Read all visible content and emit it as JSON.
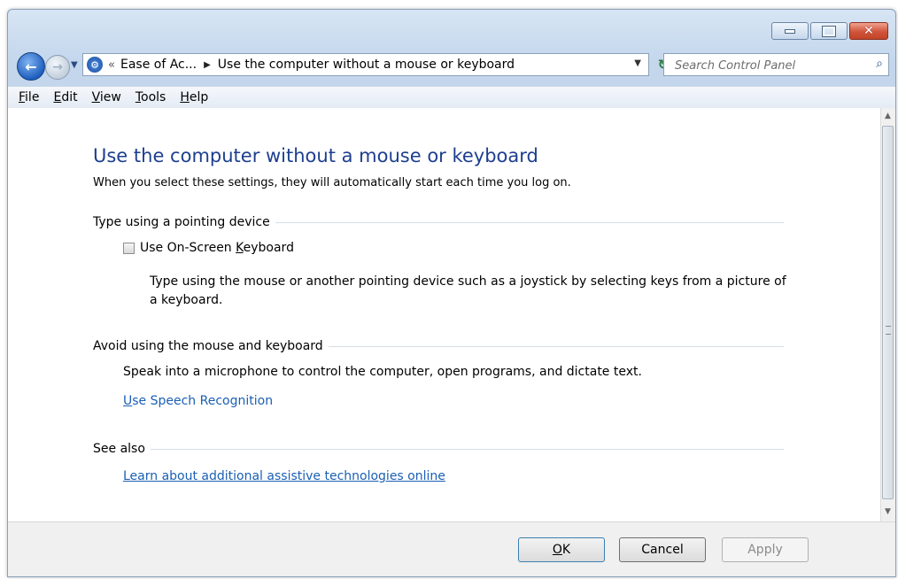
{
  "navigation": {
    "breadcrumb_collapse": "«",
    "breadcrumb_parent": "Ease of Ac...",
    "breadcrumb_current": "Use the computer without a mouse or keyboard",
    "search_placeholder": "Search Control Panel"
  },
  "menu": {
    "items": [
      {
        "accel": "F",
        "rest": "ile"
      },
      {
        "accel": "E",
        "rest": "dit"
      },
      {
        "accel": "V",
        "rest": "iew"
      },
      {
        "accel": "T",
        "rest": "ools"
      },
      {
        "accel": "H",
        "rest": "elp"
      }
    ]
  },
  "page": {
    "title": "Use the computer without a mouse or keyboard",
    "subtitle": "When you select these settings, they will automatically start each time you log on.",
    "section_pointing": "Type using a pointing device",
    "osk_label_pre": "Use On-Screen ",
    "osk_label_accel": "K",
    "osk_label_post": "eyboard",
    "osk_checked": false,
    "osk_desc_line1": "Type using the mouse or another pointing device such as a joystick by selecting keys from a picture of",
    "osk_desc_line2": "a keyboard.",
    "section_avoid": "Avoid using the mouse and keyboard",
    "speech_desc": "Speak into a microphone to control the computer, open programs, and dictate text.",
    "speech_link_accel": "U",
    "speech_link_rest": "se Speech Recognition",
    "section_see_also": "See also",
    "assistive_link": "Learn about additional assistive technologies online"
  },
  "buttons": {
    "ok_accel": "O",
    "ok_rest": "K",
    "cancel": "Cancel",
    "apply": "Apply"
  },
  "colors": {
    "title_blue": "#1e3f8f",
    "link_blue": "#1a5fb4",
    "close_red": "#c24428"
  }
}
